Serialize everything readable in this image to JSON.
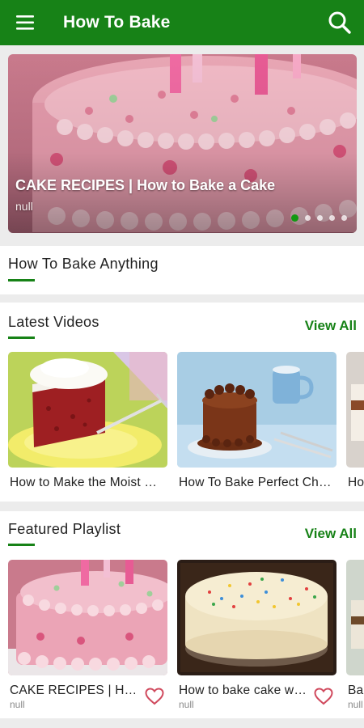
{
  "app_bar": {
    "title": "How To Bake",
    "background": "#178217"
  },
  "hero": {
    "title": "CAKE RECIPES | How to Bake a Cake",
    "subtitle": "null",
    "page_count": 5,
    "active_page": 1
  },
  "how_to": {
    "title": "How To Bake Anything"
  },
  "latest": {
    "title": "Latest Videos",
    "view_all": "View All",
    "items": [
      {
        "title": "How to Make the Moist Red Velvet Cake"
      },
      {
        "title": "How To Bake Perfect Chocolate Cake"
      },
      {
        "title": "How to Bake"
      }
    ]
  },
  "featured": {
    "title": "Featured Playlist",
    "view_all": "View All",
    "items": [
      {
        "title": "CAKE RECIPES | How to Bake a Cake",
        "subtitle": "null"
      },
      {
        "title": "How to bake cake without oven",
        "subtitle": "null"
      },
      {
        "title": "Baking Basics",
        "subtitle": "null"
      }
    ]
  },
  "colors": {
    "accent": "#178217",
    "heart": "#d0495d"
  },
  "icons": {
    "menu": "menu-icon",
    "search": "search-icon",
    "favorite": "heart-icon"
  }
}
